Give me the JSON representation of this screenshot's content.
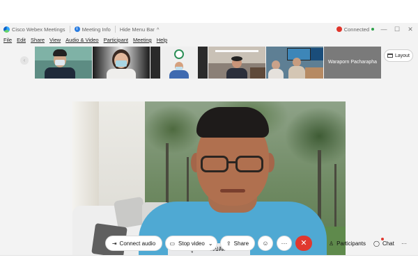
{
  "titlebar": {
    "app_name": "Cisco Webex Meetings",
    "meeting_info": "Meeting Info",
    "hide_menu_bar": "Hide Menu Bar",
    "hide_menu_chevron": "^",
    "connection_status": "Connected",
    "minimize": "—",
    "maximize": "☐",
    "close": "✕"
  },
  "menu": {
    "items": [
      "File",
      "Edit",
      "Share",
      "View",
      "Audio & Video",
      "Participant",
      "Meeting",
      "Help"
    ]
  },
  "filmstrip": {
    "prev_arrow": "‹",
    "name_tile": "Waraporn Pacharapha",
    "layout_label": "Layout"
  },
  "main_video": {
    "speaker_name": "ภูเวียง รองปลัดฯ"
  },
  "controls": {
    "connect_audio": "Connect audio",
    "stop_video": "Stop video",
    "share": "Share",
    "participants": "Participants",
    "chat": "Chat",
    "more": "···",
    "end": "✕",
    "chevron": "⌄"
  },
  "colors": {
    "end_call": "#e0382e",
    "shirt": "#4fa9d3",
    "connected_dot": "#2ea14a"
  }
}
